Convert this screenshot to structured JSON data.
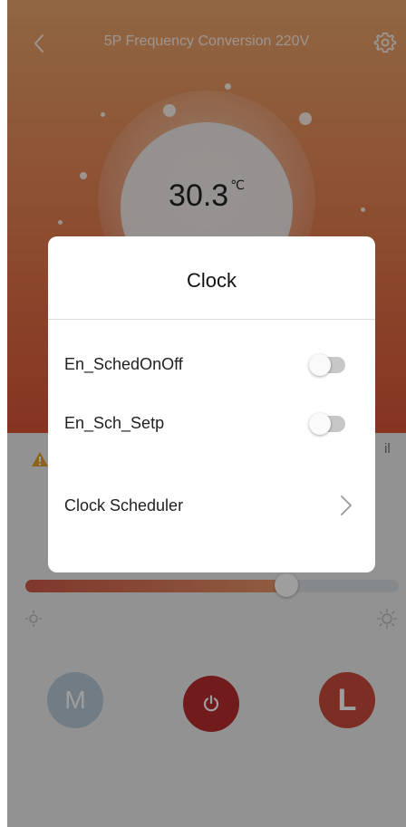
{
  "header": {
    "title": "5P Frequency Conversion 220V",
    "back_icon": "chevron-left-icon",
    "settings_icon": "gear-icon"
  },
  "status": {
    "temperature": "30.3",
    "unit": "℃",
    "partial_label": "il"
  },
  "slider": {
    "level": 0.7
  },
  "modes": {
    "m_label": "M",
    "schedule_label": "L",
    "power_icon": "power-icon"
  },
  "dialog": {
    "title": "Clock",
    "rows": [
      {
        "label": "En_SchedOnOff",
        "on": false
      },
      {
        "label": "En_Sch_Setp",
        "on": false
      },
      {
        "label": "Clock Scheduler"
      }
    ]
  },
  "colors": {
    "accent": "#d85436",
    "power": "#b82d2e",
    "mode_m": "#b9c8d6"
  }
}
